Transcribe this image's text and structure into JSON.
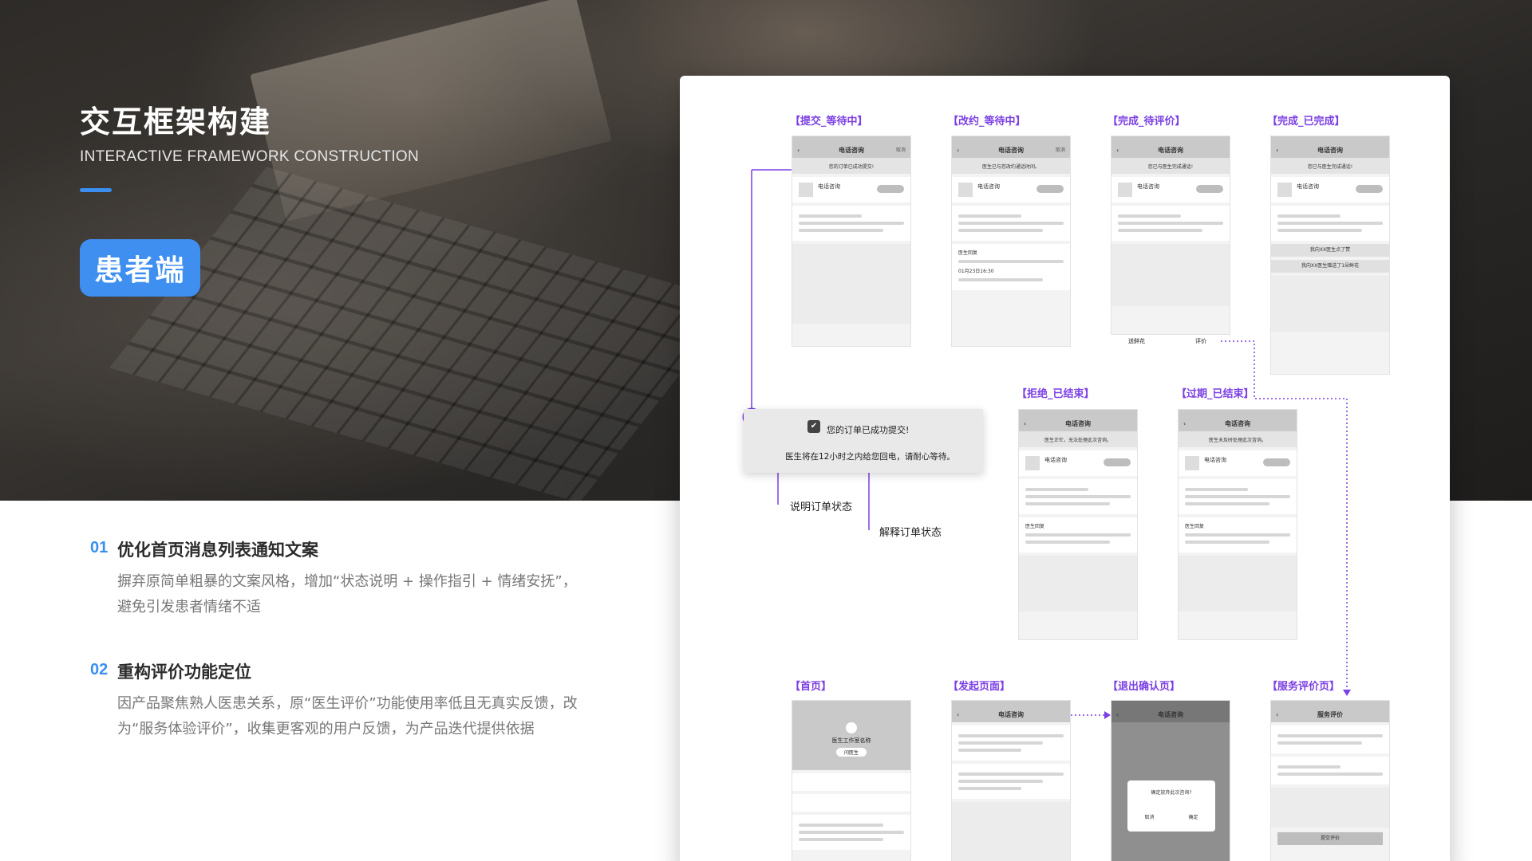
{
  "header": {
    "title": "交互框架构建",
    "subtitle": "INTERACTIVE FRAMEWORK CONSTRUCTION",
    "badge": "患者端"
  },
  "points": [
    {
      "num": "01",
      "title": "优化首页消息列表通知文案",
      "desc": "摒弃原简单粗暴的文案风格，增加“状态说明 + 操作指引 + 情绪安抚”，避免引发患者情绪不适"
    },
    {
      "num": "02",
      "title": "重构评价功能定位",
      "desc": "因产品聚焦熟人医患关系，原“医生评价”功能使用率低且无真实反馈，改为“服务体验评价”，收集更客观的用户反馈，为产品迭代提供依据"
    }
  ],
  "wireframe": {
    "screens": [
      {
        "label": "【提交_等待中】",
        "nav": "电话咨询",
        "nav_right": "取消",
        "status": "您的订单已成功提交!"
      },
      {
        "label": "【改约_等待中】",
        "nav": "电话咨询",
        "nav_right": "取消",
        "status": "医生已与您改约通话时间。"
      },
      {
        "label": "【完成_待评价】",
        "nav": "电话咨询",
        "nav_right": "",
        "status": "您已与医生完成通话!"
      },
      {
        "label": "【完成_已完成】",
        "nav": "电话咨询",
        "nav_right": "",
        "status": "您已与医生完成通话!"
      },
      {
        "label": "【拒绝_已结束】",
        "nav": "电话咨询",
        "nav_right": "",
        "status": "医生正忙，无法处理此次咨询。"
      },
      {
        "label": "【过期_已结束】",
        "nav": "电话咨询",
        "nav_right": "",
        "status": "医生未及时处理此次咨询。"
      },
      {
        "label": "【首页】",
        "nav": "医生工作室名称",
        "nav_right": "全部",
        "status": "问医生"
      },
      {
        "label": "【发起页面】",
        "nav": "电话咨询",
        "nav_right": "",
        "status": "发起电话咨询"
      },
      {
        "label": "【退出确认页】",
        "nav": "电话咨询",
        "nav_right": "",
        "status": "确定放弃此次咨询?"
      },
      {
        "label": "【服务评价页】",
        "nav": "服务评价",
        "nav_right": "",
        "status": "提交评价"
      }
    ],
    "zoom": {
      "line1": "您的订单已成功提交!",
      "line2": "医生将在12小时之内给您回电，请耐心等待。",
      "check_icon": "✔"
    },
    "annotations": {
      "a1": "说明订单状态",
      "a2": "解释订单状态"
    },
    "extra_text": {
      "doctor_name": "电话咨询",
      "reply": "医生回复",
      "btn_explain": "送鲜花",
      "btn_rate": "评价",
      "thumb": "我向XX医生点了赞",
      "flower": "我向XX医生赠送了1朵鲜花",
      "time_tag": "01月23日16:30",
      "cancel": "取消",
      "confirm": "确定"
    }
  },
  "colors": {
    "accent": "#3a8ef0",
    "purple": "#7b3fe4"
  }
}
